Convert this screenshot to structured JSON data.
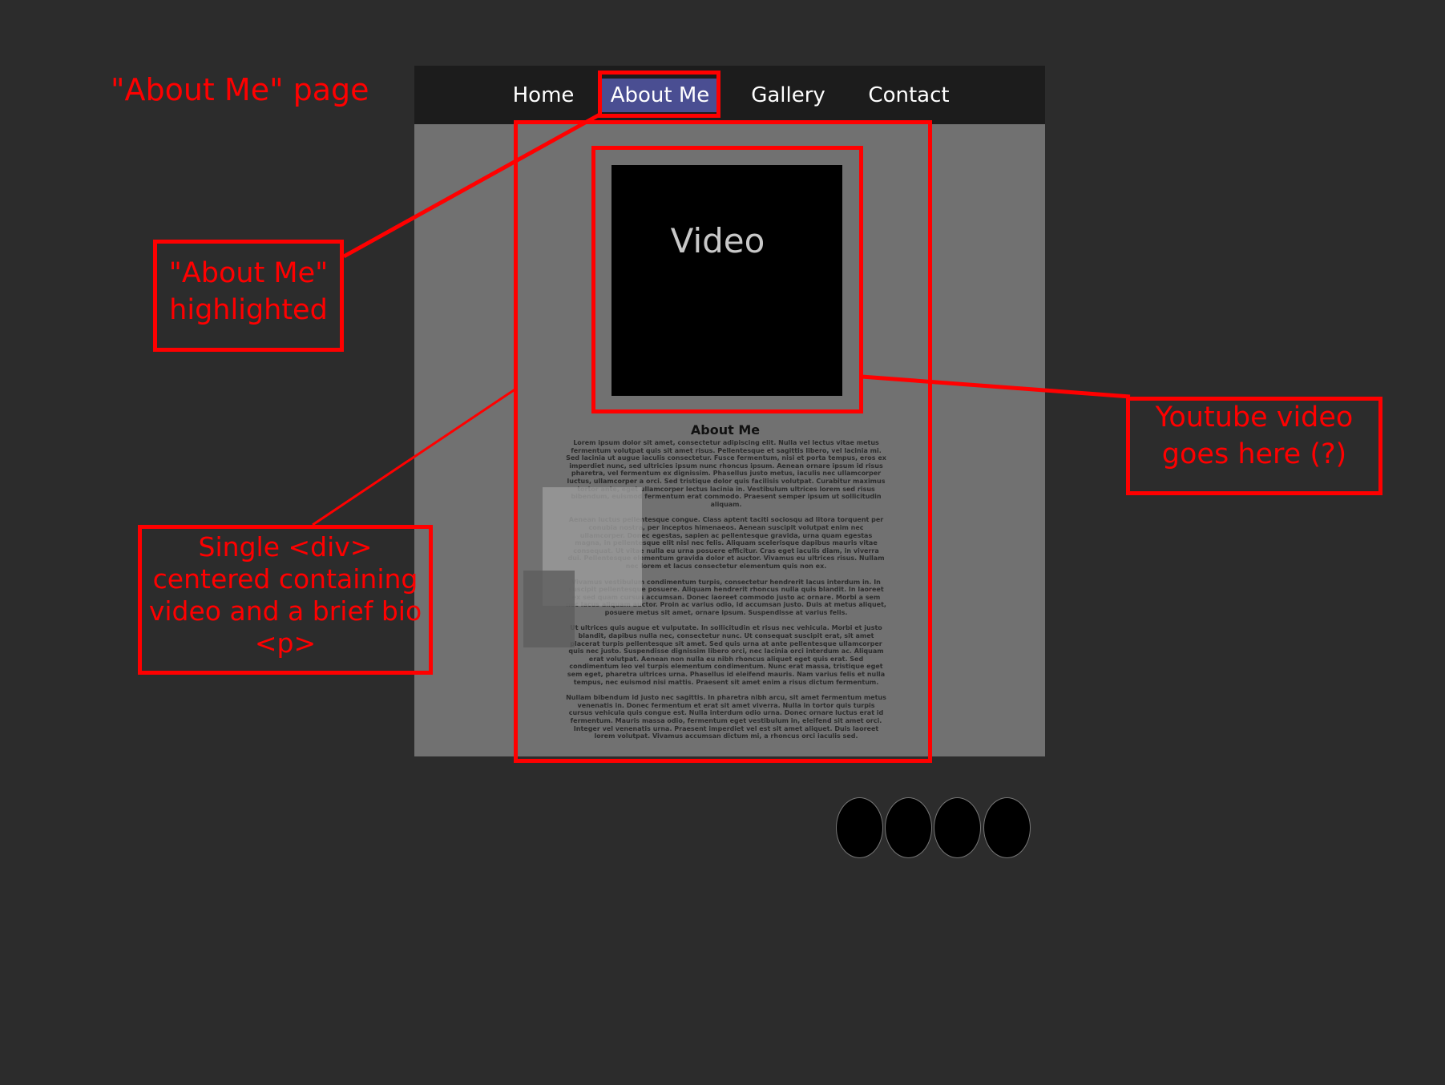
{
  "page_annotation": "\"About Me\" page",
  "nav": {
    "items": [
      "Home",
      "About Me",
      "Gallery",
      "Contact"
    ],
    "active": "About Me"
  },
  "video": {
    "label": "Video"
  },
  "bio": {
    "title": "About Me",
    "paragraphs": [
      "Lorem ipsum dolor sit amet, consectetur adipiscing elit. Nulla vel lectus vitae metus fermentum volutpat quis sit amet risus. Pellentesque et sagittis libero, vel lacinia mi. Sed lacinia ut augue iaculis consectetur. Fusce fermentum, nisi et porta tempus, eros ex imperdiet nunc, sed ultricies ipsum nunc rhoncus ipsum. Aenean ornare ipsum id risus pharetra, vel fermentum ex dignissim. Phasellus justo metus, iaculis nec ullamcorper luctus, ullamcorper a orci. Sed tristique dolor quis facilisis volutpat. Curabitur maximus tortor ante, eget ullamcorper lectus lacinia in. Vestibulum ultrices lorem sed risus bibendum, euismod fermentum erat commodo. Praesent semper ipsum ut sollicitudin aliquam.",
      "Aenean luctus pellentesque congue. Class aptent taciti sociosqu ad litora torquent per conubia nostra, per inceptos himenaeos. Aenean suscipit volutpat enim nec ullamcorper. Donec egestas, sapien ac pellentesque gravida, urna quam egestas magna, in pellentesque elit nisl nec felis. Aliquam scelerisque dapibus mauris vitae consequat. Ut vitae nulla eu urna posuere efficitur. Cras eget iaculis diam, in viverra dui. Pellentesque elementum gravida dolor et auctor. Vivamus eu ultrices risus. Nullam nec lorem et lacus consectetur elementum quis non ex.",
      "Vivamus vestibulum condimentum turpis, consectetur hendrerit lacus interdum in. In suscipit pellentesque posuere. Aliquam hendrerit rhoncus nulla quis blandit. In laoreet ex sed quam cursus accumsan. Donec laoreet commodo justo ac ornare. Morbi a sem nec lacus aliquam auctor. Proin ac varius odio, id accumsan justo. Duis at metus aliquet, posuere metus sit amet, ornare ipsum. Suspendisse at varius felis.",
      "Ut ultrices quis augue et vulputate. In sollicitudin et risus nec vehicula. Morbi et justo blandit, dapibus nulla nec, consectetur nunc. Ut consequat suscipit erat, sit amet placerat turpis pellentesque sit amet. Sed quis urna at ante pellentesque ullamcorper quis nec justo. Suspendisse dignissim libero orci, nec lacinia orci interdum ac. Aliquam erat volutpat. Aenean non nulla eu nibh rhoncus aliquet eget quis erat. Sed condimentum leo vel turpis elementum condimentum. Nunc erat massa, tristique eget sem eget, pharetra ultrices urna. Phasellus id eleifend mauris. Nam varius felis et nulla tempus, nec euismod nisi mattis. Praesent sit amet enim a risus dictum fermentum.",
      "Nullam bibendum id justo nec sagittis. In pharetra nibh arcu, sit amet fermentum metus venenatis in. Donec fermentum et erat sit amet viverra. Nulla in tortor quis turpis cursus vehicula quis congue est. Nulla interdum odio urna. Donec ornare luctus erat id fermentum. Mauris massa odio, fermentum eget vestibulum in, eleifend sit amet orci. Integer vel venenatis urna. Praesent imperdiet vel est sit amet aliquet. Duis laoreet lorem volutpat. Vivamus accumsan dictum mi, a rhoncus orci iaculis sed."
    ]
  },
  "annotations": {
    "highlight": [
      "\"About Me\"",
      "highlighted"
    ],
    "video_note": [
      "Youtube video",
      "goes here (?)"
    ],
    "div_note": [
      "Single <div>",
      "centered containing",
      "video and a brief bio",
      "<p>"
    ]
  },
  "colors": {
    "background": "#2c2c2c",
    "annotation": "#ff0000",
    "nav_active": "#4a4e92",
    "navbar": "#1c1c1c",
    "site_body": "#717171"
  },
  "social_icons": [
    "social-icon-1",
    "social-icon-2",
    "social-icon-3",
    "social-icon-4"
  ]
}
